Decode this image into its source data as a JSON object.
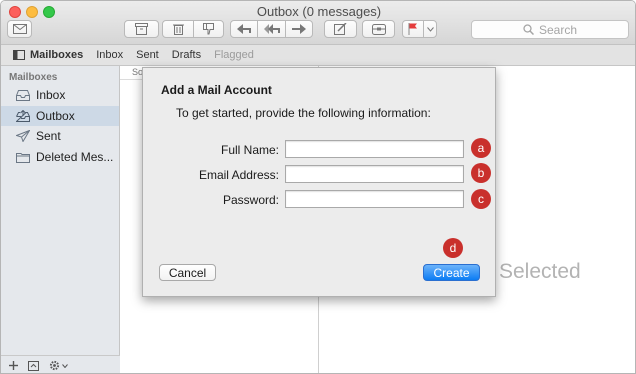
{
  "window": {
    "title": "Outbox (0 messages)"
  },
  "toolbar": {
    "search_placeholder": "Search"
  },
  "favorites": {
    "mailboxes": "Mailboxes",
    "inbox": "Inbox",
    "sent": "Sent",
    "drafts": "Drafts",
    "flagged": "Flagged"
  },
  "sidebar": {
    "heading": "Mailboxes",
    "items": [
      {
        "label": "Inbox",
        "icon": "inbox-tray-icon"
      },
      {
        "label": "Outbox",
        "icon": "outbox-tray-icon",
        "selected": true
      },
      {
        "label": "Sent",
        "icon": "paper-plane-icon"
      },
      {
        "label": "Deleted Mes...",
        "icon": "folder-icon"
      }
    ]
  },
  "message_list": {
    "sort_label": "So"
  },
  "viewer": {
    "empty_text": "Selected"
  },
  "sheet": {
    "title": "Add a Mail Account",
    "subtitle": "To get started, provide the following information:",
    "fields": [
      {
        "label": "Full Name:",
        "value": "",
        "callout": "a"
      },
      {
        "label": "Email Address:",
        "value": "",
        "callout": "b"
      },
      {
        "label": "Password:",
        "value": "",
        "callout": "c"
      }
    ],
    "create_callout": "d",
    "cancel_label": "Cancel",
    "create_label": "Create"
  },
  "colors": {
    "accent": "#0b7cf4",
    "callout": "#c9302c",
    "sidebar_selected": "#cdd9e6"
  }
}
